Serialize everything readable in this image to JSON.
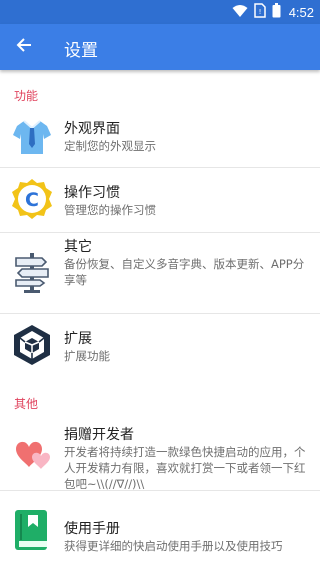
{
  "status_bar": {
    "time": "4:52"
  },
  "app_bar": {
    "title": "设置"
  },
  "sections": {
    "features": "功能",
    "others": "其他"
  },
  "items": [
    {
      "title": "外观界面",
      "desc": "定制您的外观显示"
    },
    {
      "title": "操作习惯",
      "desc": "管理您的操作习惯"
    },
    {
      "title": "其它",
      "desc": "备份恢复、自定义多音字典、版本更新、APP分享等"
    },
    {
      "title": "扩展",
      "desc": "扩展功能"
    },
    {
      "title": "捐赠开发者",
      "desc": "开发者将持续打造一款绿色快捷启动的应用，个人开发精力有限，喜欢就打赏一下或者领一下红包吧~\\\\(//∇//)\\\\"
    },
    {
      "title": "使用手册",
      "desc": "获得更详细的快启动使用手册以及使用技巧"
    }
  ],
  "icon_letter": "C",
  "colors": {
    "status_bar": "#2f6fd1",
    "app_bar": "#3b7ee6",
    "section_header": "#e0435d"
  }
}
